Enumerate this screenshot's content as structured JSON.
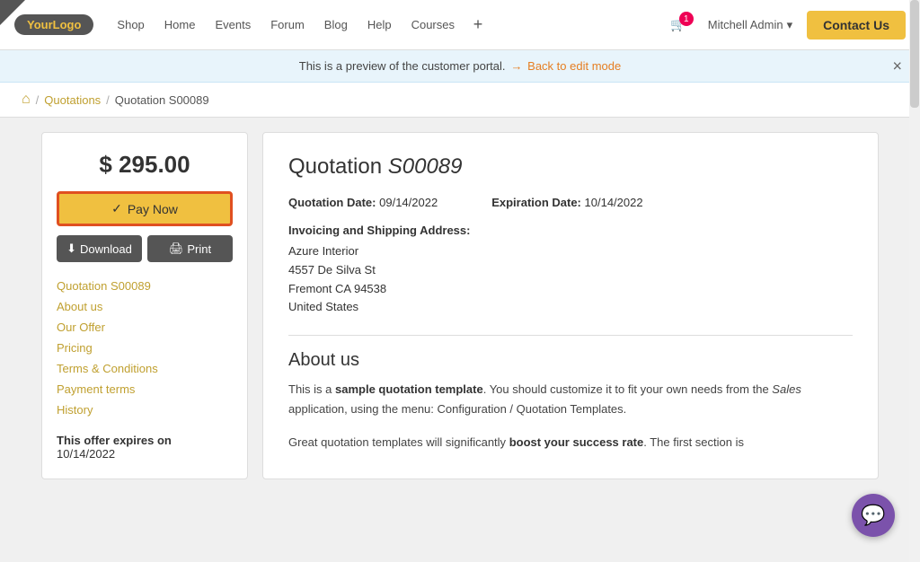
{
  "corner": {
    "label": "▲"
  },
  "navbar": {
    "logo_text": "YourLogo",
    "logo_prefix": "Your",
    "logo_suffix": "Logo",
    "links": [
      {
        "label": "Shop"
      },
      {
        "label": "Home"
      },
      {
        "label": "Events"
      },
      {
        "label": "Forum"
      },
      {
        "label": "Blog"
      },
      {
        "label": "Help"
      },
      {
        "label": "Courses"
      }
    ],
    "cart_count": "1",
    "user_name": "Mitchell Admin",
    "contact_label": "Contact Us"
  },
  "preview_banner": {
    "text": "This is a preview of the customer portal.",
    "back_link": "Back to edit mode",
    "close": "×"
  },
  "breadcrumb": {
    "home_icon": "⌂",
    "sep": "/",
    "link": "Quotations",
    "current": "Quotation S00089"
  },
  "left_panel": {
    "price": "$ 295.00",
    "pay_now_check": "✓",
    "pay_now_label": "Pay Now",
    "download_icon": "⬇",
    "download_label": "Download",
    "print_icon": "🖨",
    "print_label": "Print",
    "nav_links": [
      {
        "label": "Quotation S00089"
      },
      {
        "label": "About us"
      },
      {
        "label": "Our Offer"
      },
      {
        "label": "Pricing"
      },
      {
        "label": "Terms & Conditions"
      },
      {
        "label": "Payment terms"
      },
      {
        "label": "History"
      }
    ],
    "expiry_label": "This offer expires on",
    "expiry_date": "10/14/2022"
  },
  "right_panel": {
    "title_prefix": "Quotation ",
    "title_italic": "S00089",
    "quotation_date_label": "Quotation Date:",
    "quotation_date_value": "09/14/2022",
    "expiration_date_label": "Expiration Date:",
    "expiration_date_value": "10/14/2022",
    "address_heading": "Invoicing and Shipping Address:",
    "address_line1": "Azure Interior",
    "address_line2": "4557 De Silva St",
    "address_line3": "Fremont CA 94538",
    "address_line4": "United States",
    "about_title": "About us",
    "about_p1_pre": "This is a ",
    "about_p1_bold": "sample quotation template",
    "about_p1_post": ". You should customize it to fit your own needs from the ",
    "about_p1_italic": "Sales",
    "about_p1_post2": " application, using the menu: Configuration / Quotation Templates.",
    "about_p2_pre": "Great quotation templates will significantly ",
    "about_p2_bold": "boost your success rate",
    "about_p2_post": ". The first section is"
  },
  "chat": {
    "icon": "💬"
  }
}
